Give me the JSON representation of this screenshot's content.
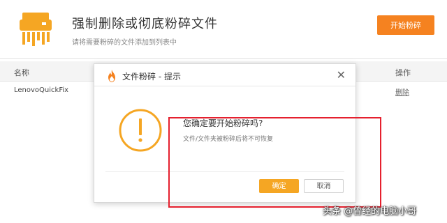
{
  "header": {
    "title": "强制删除或彻底粉碎文件",
    "subtitle": "请将需要粉碎的文件添加到列表中",
    "start_button": "开始粉碎",
    "icon": "shredder-icon"
  },
  "table": {
    "columns": {
      "name": "名称",
      "action": "操作"
    },
    "rows": [
      {
        "name": "LenovoQuickFix",
        "action": "删除"
      }
    ]
  },
  "dialog": {
    "title": "文件粉碎 - 提示",
    "close_icon": "close-icon",
    "warning_icon": "exclamation-circle-icon",
    "question": "您确定要开始粉碎吗?",
    "detail": "文件/文件夹被粉碎后将不可恢复",
    "ok_label": "确定",
    "cancel_label": "取消"
  },
  "watermark": "头条 @曾经的电脑小哥",
  "colors": {
    "accent": "#f58220",
    "ok_button": "#f5a623",
    "warning_icon": "#f5a623",
    "highlight_box": "#e5202e"
  }
}
